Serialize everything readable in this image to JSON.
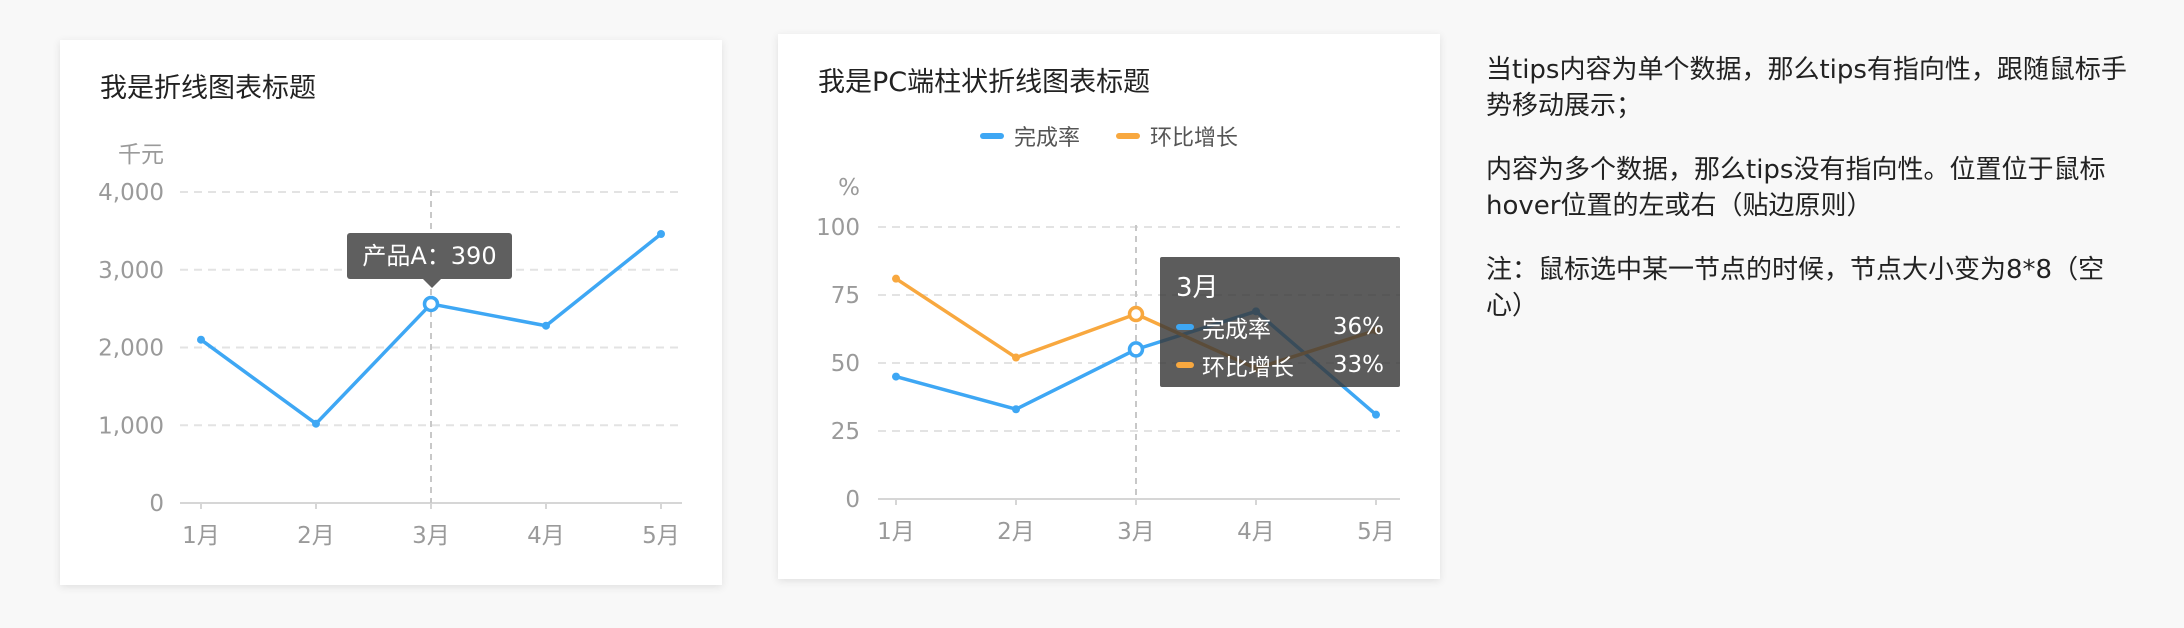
{
  "chart1": {
    "title": "我是折线图表标题",
    "unit": "千元",
    "tooltip": "产品A：390",
    "colors": {
      "line": "#3ea7f4"
    }
  },
  "chart2": {
    "title": "我是PC端柱状折线图表标题",
    "unit": "%",
    "legend": [
      "完成率",
      "环比增长"
    ],
    "tooltip": {
      "title": "3月",
      "rows": [
        {
          "label": "完成率",
          "value": "36%"
        },
        {
          "label": "环比增长",
          "value": "33%"
        }
      ]
    },
    "colors": {
      "series1": "#3ea7f4",
      "series2": "#f8a83f"
    }
  },
  "notes": [
    "当tips内容为单个数据，那么tips有指向性，跟随鼠标手势移动展示；",
    "内容为多个数据，那么tips没有指向性。位置位于鼠标hover位置的左或右（贴边原则）",
    "注：鼠标选中某一节点的时候，节点大小变为8*8（空心）"
  ],
  "chart_data": [
    {
      "type": "line",
      "title": "我是折线图表标题",
      "ylabel": "千元",
      "categories": [
        "1月",
        "2月",
        "3月",
        "4月",
        "5月"
      ],
      "yticks": [
        "0",
        "1,000",
        "2,000",
        "3,000",
        "4,000"
      ],
      "ylim": [
        0,
        4000
      ],
      "series": [
        {
          "values": [
            2100,
            1020,
            2560,
            2280,
            3460
          ]
        }
      ],
      "highlight_index": 2,
      "grid": true
    },
    {
      "type": "line",
      "title": "我是PC端柱状折线图表标题",
      "ylabel": "%",
      "categories": [
        "1月",
        "2月",
        "3月",
        "4月",
        "5月"
      ],
      "yticks": [
        "0",
        "25",
        "50",
        "75",
        "100"
      ],
      "ylim": [
        0,
        100
      ],
      "series": [
        {
          "name": "完成率",
          "values": [
            45,
            33,
            55,
            69,
            31
          ]
        },
        {
          "name": "环比增长",
          "values": [
            81,
            52,
            68,
            48,
            62
          ]
        }
      ],
      "highlight_index": 2,
      "legend": "top-center",
      "grid": true
    }
  ]
}
